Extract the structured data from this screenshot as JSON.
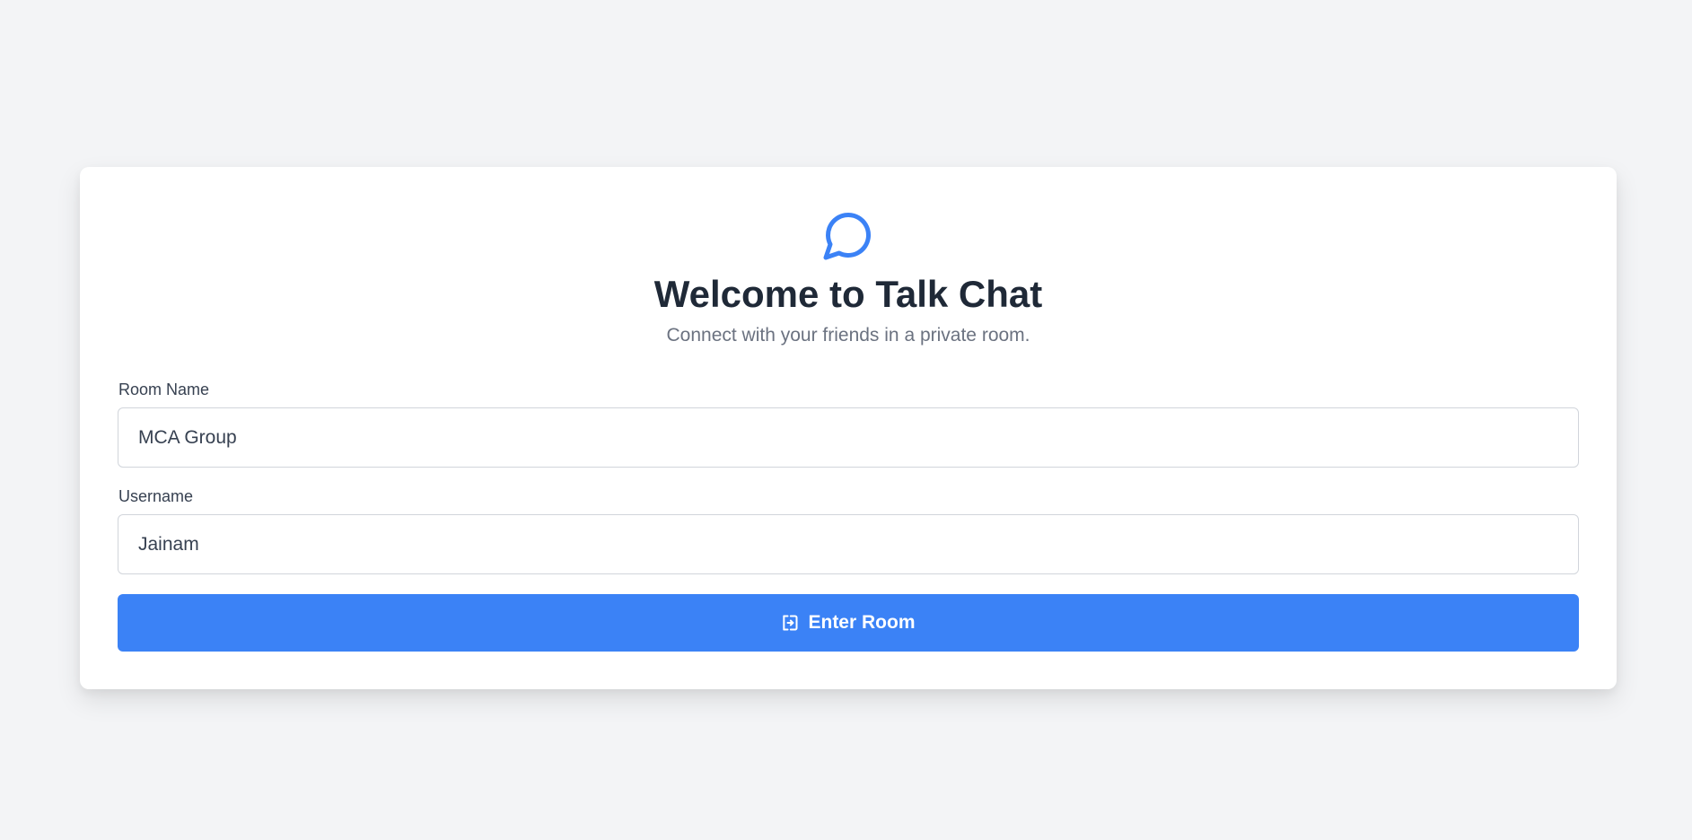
{
  "header": {
    "logo_icon": "chat-bubble-icon",
    "title": "Welcome to Talk Chat",
    "subtitle": "Connect with your friends in a private room."
  },
  "form": {
    "room_label": "Room Name",
    "room_value": "MCA Group",
    "username_label": "Username",
    "username_value": "Jainam",
    "submit_label": "Enter Room",
    "submit_icon": "enter-icon"
  },
  "colors": {
    "accent": "#3b82f6",
    "background": "#f3f4f6",
    "title": "#1f2937",
    "muted": "#6b7280"
  }
}
